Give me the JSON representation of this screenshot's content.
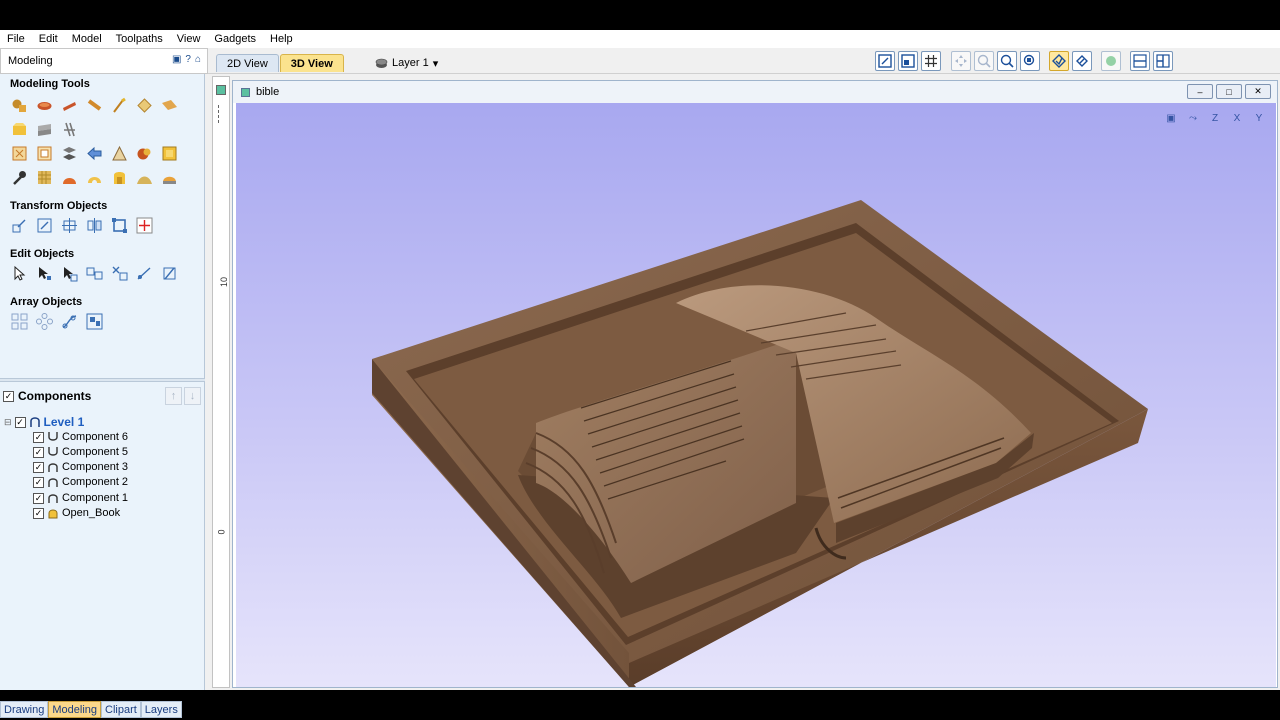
{
  "menu": [
    "File",
    "Edit",
    "Model",
    "Toolpaths",
    "View",
    "Gadgets",
    "Help"
  ],
  "panel": {
    "title": "Modeling"
  },
  "tabs": {
    "view2d": "2D View",
    "view3d": "3D View"
  },
  "layer": {
    "label": "Layer 1",
    "arrow": "▾"
  },
  "sections": {
    "modeling_tools": "Modeling Tools",
    "transform_objects": "Transform Objects",
    "edit_objects": "Edit Objects",
    "array_objects": "Array Objects"
  },
  "components": {
    "header": "Components",
    "level": "Level 1",
    "items": [
      "Component 6",
      "Component 5",
      "Component 3",
      "Component 2",
      "Component 1",
      "Open_Book"
    ]
  },
  "bottom_tabs": [
    "Drawing",
    "Modeling",
    "Clipart",
    "Layers"
  ],
  "document": {
    "title": "bible"
  },
  "ruler": {
    "t1": "10",
    "t2": "0"
  },
  "axis_buttons": [
    "Z",
    "X",
    "Y"
  ],
  "colors": {
    "wood": "#7a5840",
    "viewport_top": "#a8a8f0",
    "active_tab": "#fbe38e"
  }
}
